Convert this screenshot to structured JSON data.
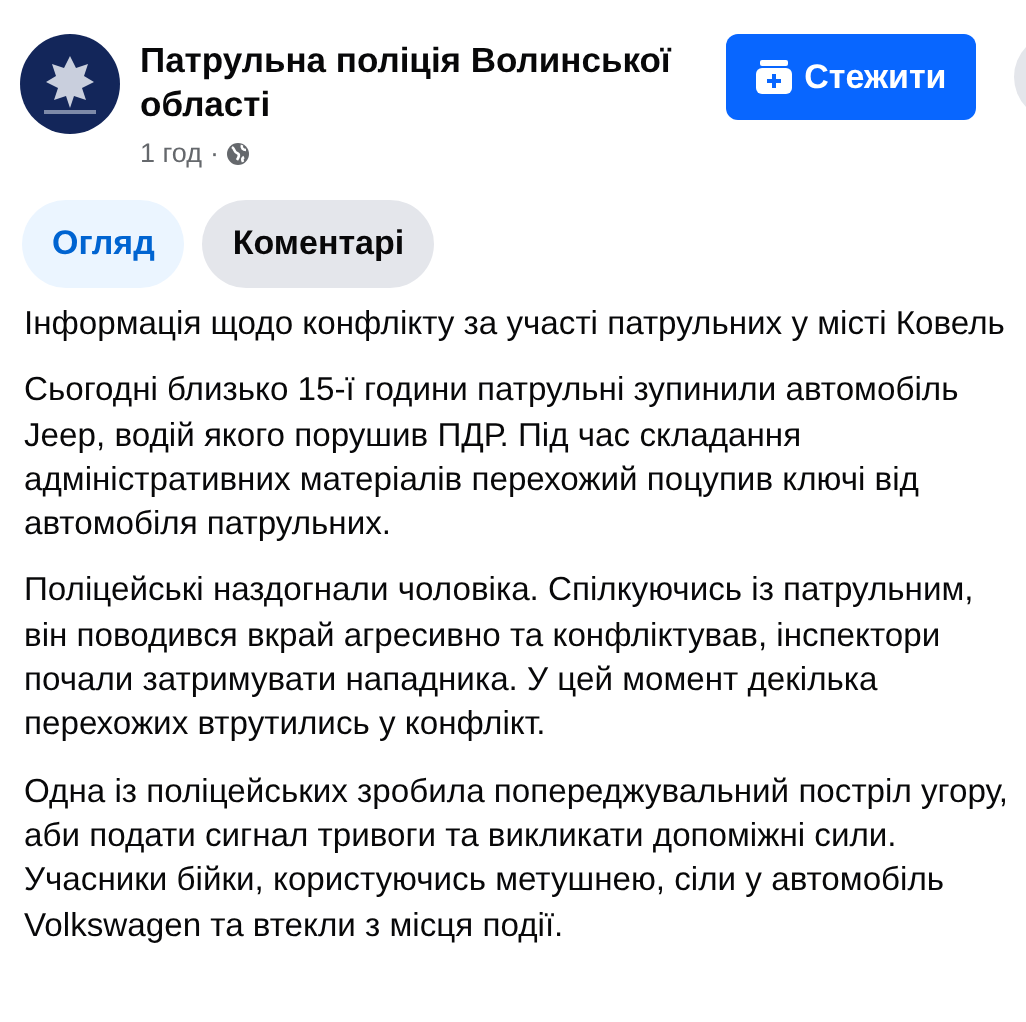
{
  "post_header": {
    "page_name": "Патрульна поліція Волинської області",
    "time": "1 год",
    "separator": "·",
    "follow_button": "Стежити"
  },
  "tabs": [
    {
      "label": "Огляд",
      "selected": true
    },
    {
      "label": "Коментарі",
      "selected": false
    }
  ],
  "paragraphs": [
    "Інформація щодо конфлікту за участі патрульних у місті Ковель",
    "Сьогодні близько 15-ї години патрульні зупинили автомобіль Jeep, водій якого порушив ПДР. Під час складання адміністративних матеріалів перехожий поцупив ключі від автомобіля патрульних.",
    "Поліцейські наздогнали чоловіка. Спілкуючись із патрульним, він поводився вкрай агресивно та конфліктував, інспектори почали затримувати нападника. У цей момент декілька перехожих втрутились у конфлікт.",
    "Одна із поліцейських зробила попереджувальний постріл угору, аби подати сигнал тривоги та викликати допоміжні сили. Учасники бійки, користуючись метушнею, сіли у автомобіль Volkswagen та втекли з місця події."
  ]
}
